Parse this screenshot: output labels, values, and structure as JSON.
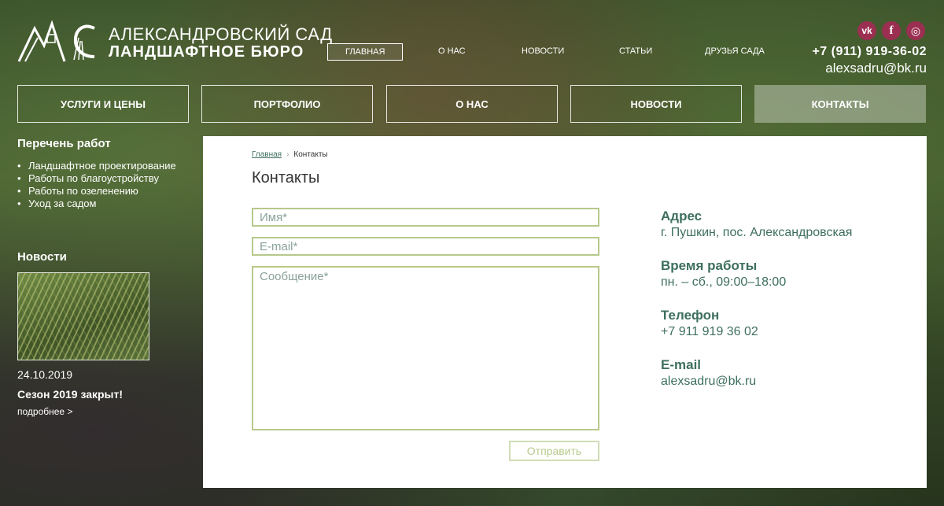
{
  "header": {
    "logo": {
      "line1": "АЛЕКСАНДРОВСКИЙ САД",
      "line2": "ЛАНДШАФТНОЕ БЮРО"
    },
    "top_nav": [
      "ГЛАВНАЯ",
      "О НАС",
      "НОВОСТИ",
      "СТАТЬИ",
      "ДРУЗЬЯ САДА"
    ],
    "top_nav_active": "ГЛАВНАЯ",
    "social": [
      {
        "icon": "vk-icon",
        "glyph": "vk"
      },
      {
        "icon": "facebook-icon",
        "glyph": "f"
      },
      {
        "icon": "instagram-icon",
        "glyph": "◎"
      }
    ],
    "phone": "+7 (911) 919-36-02",
    "email": "alexsadru@bk.ru"
  },
  "main_nav": [
    "УСЛУГИ И ЦЕНЫ",
    "ПОРТФОЛИО",
    "О НАС",
    "НОВОСТИ",
    "КОНТАКТЫ"
  ],
  "main_nav_active": "КОНТАКТЫ",
  "sidebar": {
    "works_title": "Перечень работ",
    "works": [
      "Ландшафтное проектирование",
      "Работы по благоустройству",
      "Работы по озеленению",
      "Уход за садом"
    ],
    "news_title": "Новости",
    "news": {
      "date": "24.10.2019",
      "title": "Сезон 2019 закрыт!",
      "more": "подробнее  >"
    }
  },
  "content": {
    "breadcrumb": {
      "home": "Главная",
      "sep": "›",
      "current": "Контакты"
    },
    "title": "Контакты",
    "form": {
      "name_placeholder": "Имя*",
      "email_placeholder": "E-mail*",
      "message_placeholder": "Сообщение*",
      "submit": "Отправить"
    },
    "info": [
      {
        "label": "Адрес",
        "value": "г. Пушкин, пос. Александровская"
      },
      {
        "label": "Время работы",
        "value": "пн. – сб., 09:00–18:00"
      },
      {
        "label": "Телефон",
        "value": "+7 911 919 36 02"
      },
      {
        "label": "E-mail",
        "value": "alexsadru@bk.ru"
      }
    ]
  },
  "colors": {
    "accent_green": "#3e6f5f",
    "field_border": "#b7c98b",
    "social_bg": "#9b2f52"
  }
}
